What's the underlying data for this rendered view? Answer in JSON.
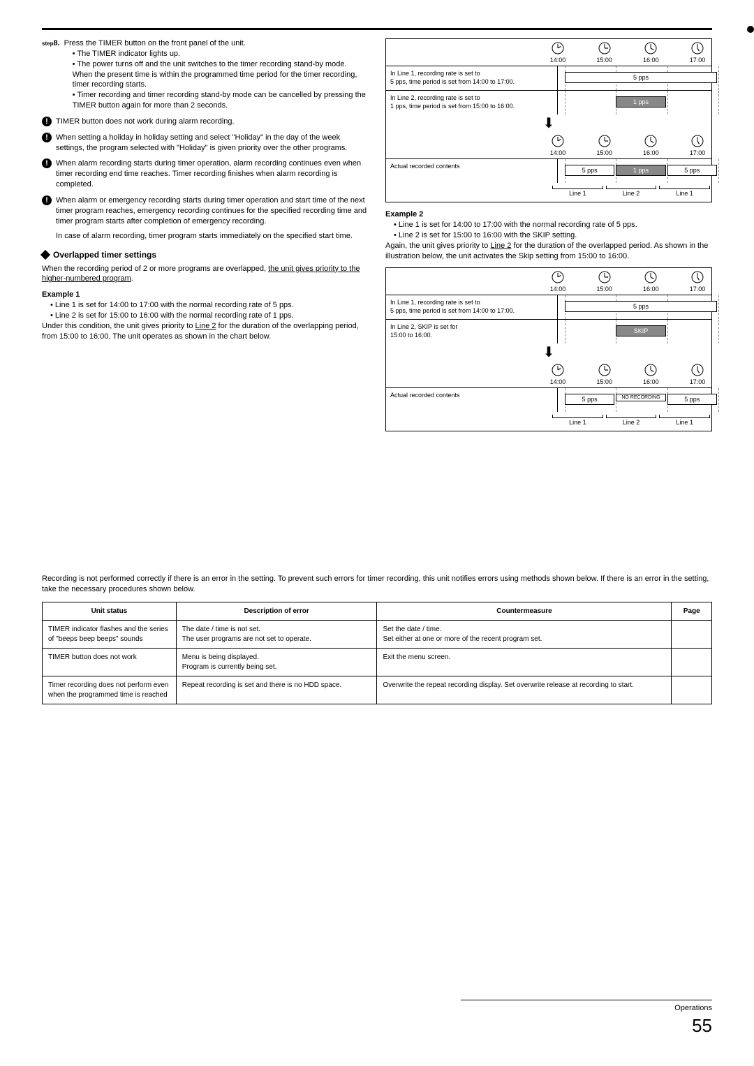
{
  "step": {
    "label": "step",
    "num": "8.",
    "text": "Press the TIMER button on the front panel of the unit.",
    "bullets": [
      "The TIMER indicator lights up.",
      "The power turns off and the unit switches to the timer recording stand-by mode. When the present time is within the programmed time period for the timer recording, timer recording starts.",
      "Timer recording and timer recording stand-by mode can be cancelled by pressing the TIMER button again for more than 2 seconds."
    ]
  },
  "notes": [
    "TIMER button does not work during alarm recording.",
    "When setting a holiday in holiday setting and select \"Holiday\" in the day of the week settings, the program selected with \"Holiday\" is given priority over the other programs.",
    "When alarm recording starts during timer operation, alarm recording continues even when timer recording end time reaches. Timer recording finishes when alarm recording is completed.",
    "When alarm or emergency recording starts during timer operation and start time of the next timer program reaches, emergency recording continues for the specified recording time and timer program starts after completion of emergency recording."
  ],
  "notes_tail": "In case of alarm recording, timer program starts immediately on the specified start time.",
  "overlap": {
    "heading": "Overlapped timer settings",
    "intro_a": "When the recording period of 2 or more programs are overlapped, ",
    "intro_u": "the unit gives priority to the higher-numbered program",
    "intro_b": ".",
    "ex1_title": "Example 1",
    "ex1_lines": [
      "Line 1 is set for 14:00 to 17:00 with the normal recording rate of 5 pps.",
      "Line 2 is set for 15:00 to 16:00 with the normal recording rate of 1 pps."
    ],
    "ex1_under_a": "Under this condition, the unit gives priority to ",
    "ex1_under_u": "Line 2",
    "ex1_under_b": " for the duration of the overlapping period, from 15:00 to 16:00. The unit operates as shown in the chart below.",
    "ex2_title": "Example 2",
    "ex2_lines": [
      "Line 1 is set for 14:00 to 17:00 with the normal recording rate of 5 pps.",
      "Line 2 is set for 15:00 to 16:00 with the SKIP setting."
    ],
    "ex2_under_a": "Again, the unit gives priority to ",
    "ex2_under_u": "Line 2",
    "ex2_under_b": " for the duration of the overlapped period. As shown in the illustration below, the unit activates the Skip setting from 15:00 to 16:00."
  },
  "chart_data": [
    {
      "type": "timeline",
      "times": [
        "14:00",
        "15:00",
        "16:00",
        "17:00"
      ],
      "rows": [
        {
          "desc_a": "In Line 1, recording rate is set to",
          "desc_b": "5 pps, time period is set from 14:00 to 17:00.",
          "bars": [
            {
              "label": "5 pps",
              "from": 0,
              "to": 3,
              "style": "light"
            }
          ]
        },
        {
          "desc_a": "In Line 2, recording rate is set to",
          "desc_b": "1 pps, time period is set from 15:00 to 16:00.",
          "bars": [
            {
              "label": "1 pps",
              "from": 1,
              "to": 2,
              "style": "dark"
            }
          ]
        }
      ],
      "result_label": "Actual recorded contents",
      "result_bars": [
        {
          "label": "5 pps",
          "from": 0,
          "to": 1,
          "style": "light"
        },
        {
          "label": "1 pps",
          "from": 1,
          "to": 2,
          "style": "dark"
        },
        {
          "label": "5 pps",
          "from": 2,
          "to": 3,
          "style": "light"
        }
      ],
      "bracket_labels": [
        "Line 1",
        "Line 2",
        "Line 1"
      ]
    },
    {
      "type": "timeline",
      "times": [
        "14:00",
        "15:00",
        "16:00",
        "17:00"
      ],
      "rows": [
        {
          "desc_a": "In Line 1, recording rate is set to",
          "desc_b": "5 pps, time period is set from 14:00 to 17:00.",
          "bars": [
            {
              "label": "5 pps",
              "from": 0,
              "to": 3,
              "style": "light"
            }
          ]
        },
        {
          "desc_a": "In Line 2, SKIP is set for",
          "desc_b": "15:00 to 16:00.",
          "bars": [
            {
              "label": "SKIP",
              "from": 1,
              "to": 2,
              "style": "dark"
            }
          ]
        }
      ],
      "result_label": "Actual recorded contents",
      "result_bars": [
        {
          "label": "5 pps",
          "from": 0,
          "to": 1,
          "style": "light"
        },
        {
          "label": "NO RECORDING",
          "from": 1,
          "to": 2,
          "style": "none"
        },
        {
          "label": "5 pps",
          "from": 2,
          "to": 3,
          "style": "light"
        }
      ],
      "bracket_labels": [
        "Line 1",
        "Line 2",
        "Line 1"
      ]
    }
  ],
  "errors": {
    "intro": "Recording is not performed correctly if there is an error in the setting. To prevent such errors for timer recording, this unit notifies errors using methods shown below. If there is an error in the setting, take the necessary procedures shown below.",
    "headers": [
      "Unit status",
      "Description of error",
      "Countermeasure",
      "Page"
    ],
    "rows": [
      {
        "status": "TIMER indicator flashes and the series of \"beeps beep beeps\" sounds",
        "desc": "The date / time is not set.\nThe user programs are not set to operate.",
        "counter": "Set the date / time.\nSet either at one or more of the recent program set.",
        "page": ""
      },
      {
        "status": "TIMER button does not work",
        "desc": "Menu is being displayed.\nProgram is currently being set.",
        "counter": "Exit the menu screen.",
        "page": ""
      },
      {
        "status": "Timer recording does not perform even when the programmed time is reached",
        "desc": "Repeat recording is set and there is no HDD space.",
        "counter": "Overwrite the repeat recording display. Set overwrite release at recording to start.",
        "page": ""
      }
    ]
  },
  "footer": {
    "section": "Operations",
    "page": "55"
  }
}
